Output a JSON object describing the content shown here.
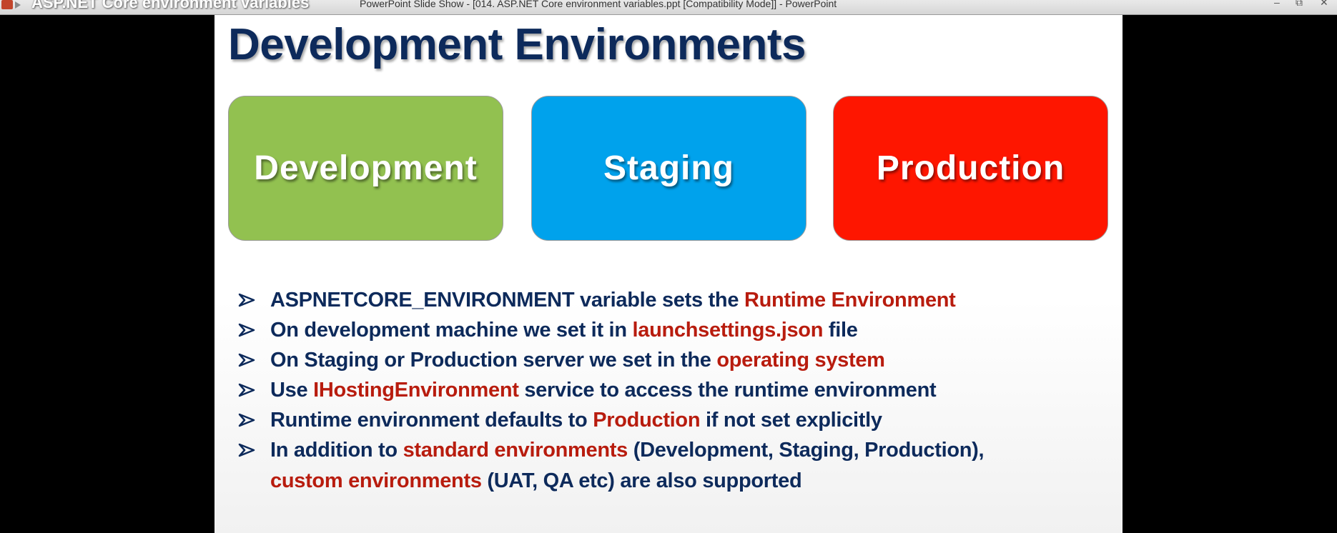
{
  "window": {
    "doc_title": "ASP.NET Core environment variables",
    "title": "PowerPoint Slide Show - [014. ASP.NET Core environment variables.ppt [Compatibility Mode]] - PowerPoint",
    "min_glyph": "–",
    "max_glyph": "⧉",
    "close_glyph": "✕"
  },
  "slide": {
    "title": "Development Environments",
    "environments": [
      {
        "label": "Development",
        "color": "#92c150"
      },
      {
        "label": "Staging",
        "color": "#00a2ec"
      },
      {
        "label": "Production",
        "color": "#fe1600"
      }
    ],
    "bullets": [
      {
        "segments": [
          {
            "text": "ASPNETCORE_ENVIRONMENT variable sets the ",
            "highlight": false
          },
          {
            "text": "Runtime Environment",
            "highlight": true
          }
        ]
      },
      {
        "segments": [
          {
            "text": "On development machine we set it in ",
            "highlight": false
          },
          {
            "text": "launchsettings.json",
            "highlight": true
          },
          {
            "text": " file",
            "highlight": false
          }
        ]
      },
      {
        "segments": [
          {
            "text": "On Staging or Production server we set in the ",
            "highlight": false
          },
          {
            "text": "operating system",
            "highlight": true
          }
        ]
      },
      {
        "segments": [
          {
            "text": "Use ",
            "highlight": false
          },
          {
            "text": "IHostingEnvironment",
            "highlight": true
          },
          {
            "text": " service to access the runtime environment",
            "highlight": false
          }
        ]
      },
      {
        "segments": [
          {
            "text": "Runtime environment defaults to ",
            "highlight": false
          },
          {
            "text": "Production",
            "highlight": true
          },
          {
            "text": " if not set explicitly",
            "highlight": false
          }
        ]
      },
      {
        "segments": [
          {
            "text": "In addition to ",
            "highlight": false
          },
          {
            "text": "standard environments",
            "highlight": true
          },
          {
            "text": " (Development, Staging, Production),",
            "highlight": false
          }
        ],
        "continuation": [
          {
            "text": "custom environments",
            "highlight": true
          },
          {
            "text": " (UAT, QA etc) are also supported",
            "highlight": false
          }
        ]
      }
    ],
    "colors": {
      "title_text": "#0d2a5b",
      "body_text": "#0d2a5b",
      "highlight_text": "#b81c0e"
    },
    "bullet_icon": "arrow-bullet-icon"
  }
}
